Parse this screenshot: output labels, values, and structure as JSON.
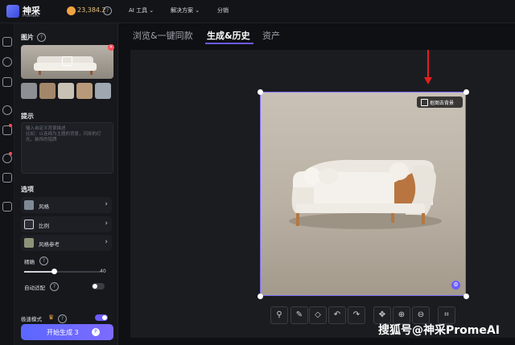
{
  "header": {
    "brand_name": "神采",
    "brand_sub": "PromeAI",
    "credits": "23,384.2",
    "menu": [
      "AI 工具",
      "解决方案",
      "分销"
    ]
  },
  "panel": {
    "image_label": "图片",
    "prompt_label": "提示",
    "prompt_placeholder": "输入自定义背景描述\n比如：以连绵为主题的背景，闪烁的灯光，装饰的铭牌",
    "options_label": "选项",
    "options": [
      {
        "label": "风格"
      },
      {
        "label": "比例"
      },
      {
        "label": "风格参考"
      }
    ],
    "precision_label": "精确",
    "precision_value": "40",
    "auto_fit_label": "自动适配",
    "mode_label": "极速模式",
    "generate_label": "开始生成 3"
  },
  "tabs": [
    "浏览&一键同款",
    "生成&历史",
    "资产"
  ],
  "canvas": {
    "remove_bg_label": "抠图去背景"
  },
  "watermark": "搜狐号@神采PromeAI",
  "colors": {
    "accent": "#6b5cff",
    "arrow": "#e02020"
  }
}
